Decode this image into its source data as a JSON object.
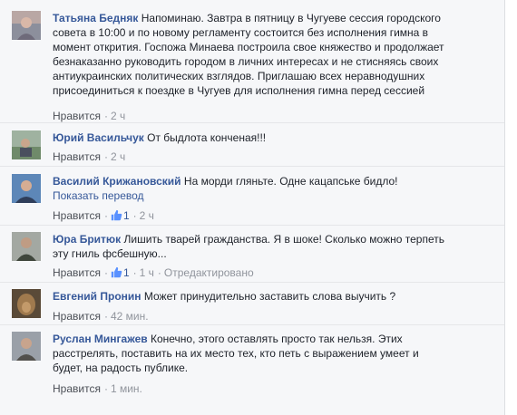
{
  "comments": [
    {
      "author": "Татьяна Бедняк",
      "lines": [
        "Напоминаю. Завтра в пятницу в Чугуеве сессия городского",
        "совета в 10:00 и по новому регламенту состоится без исполнения гимна в",
        "момент открития. Госпожа Минаева построила свое княжество и продолжает",
        "безнаказанно руководить городом в личних интересах и не стисняясь своих",
        "антиукраинских политических взглядов. Приглашаю всех неравнодушних",
        "присоединиться к поездке в Чугуев для исполнения гимна перед сессией"
      ],
      "like_label": "Нравится",
      "time": "2 ч"
    },
    {
      "author": "Юрий Васильчук",
      "lines": [
        "От быдлота конченая!!!"
      ],
      "like_label": "Нравится",
      "time": "2 ч"
    },
    {
      "author": "Василий Крижановский",
      "lines": [
        "На морди гляньте. Одне кацапське бидло!"
      ],
      "translate": "Показать перевод",
      "like_label": "Нравится",
      "likes": "1",
      "time": "2 ч"
    },
    {
      "author": "Юра Бритюк",
      "lines": [
        "Лишить тварей гражданства. Я в шоке! Сколько можно терпеть",
        "эту гниль фсбешную..."
      ],
      "like_label": "Нравится",
      "likes": "1",
      "time": "1 ч",
      "edited": "Отредактировано"
    },
    {
      "author": "Евгений Пронин",
      "lines": [
        "Может принудительно заставить слова выучить ?"
      ],
      "like_label": "Нравится",
      "time": "42 мин."
    },
    {
      "author": "Руслан Мингажев",
      "lines": [
        "Конечно, этого оставлять просто так нельзя. Этих",
        "расстрелять, поставить на их место тех, кто петь с выражением умеет и",
        "будет, на радость публике."
      ],
      "like_label": "Нравится",
      "time": "1 мин."
    }
  ],
  "icons": {
    "like_thumb": "thumbs-up-icon"
  },
  "colors": {
    "author": "#365899",
    "meta": "#90949c",
    "background": "#f6f7f9",
    "like_thumb": "#5890ff"
  }
}
